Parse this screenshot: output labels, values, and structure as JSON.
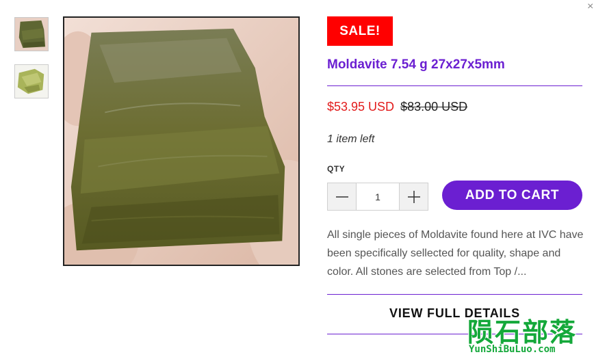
{
  "gallery": {
    "thumbnails": [
      {
        "icon": "moldavite-thumbnail-1"
      },
      {
        "icon": "moldavite-thumbnail-2"
      }
    ],
    "main_image": "moldavite-product-photo"
  },
  "product": {
    "badge": "SALE!",
    "title": "Moldavite 7.54 g 27x27x5mm",
    "price": "$53.95 USD",
    "compare_price": "$83.00 USD",
    "stock": "1 item left",
    "qty_label": "QTY",
    "qty_value": "1",
    "add_to_cart": "ADD TO CART",
    "description": "All single pieces of Moldavite found here at IVC have been specifically sellected for quality, shape and color. All stones are selected from Top /...",
    "view_details": "VIEW FULL DETAILS"
  },
  "modal": {
    "close_icon": "close-icon"
  },
  "watermark": {
    "chinese": "陨石部落",
    "latin": "YunShiBuLuo.com"
  },
  "colors": {
    "accent": "#6b1fd1",
    "sale": "#ff0000",
    "price": "#e21b1b",
    "watermark": "#14a83a"
  }
}
